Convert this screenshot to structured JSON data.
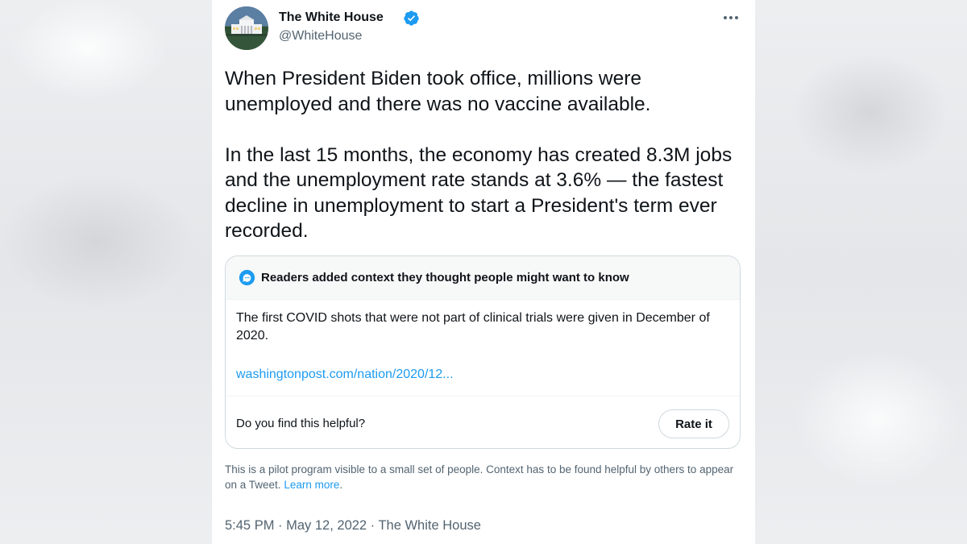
{
  "account": {
    "name": "The White House",
    "handle": "@WhiteHouse",
    "verified_color": "#1d9bf0"
  },
  "tweet": {
    "text": "When President Biden took office, millions were unemployed and there was no vaccine available.\n\nIn the last 15 months, the economy has created 8.3M jobs and the unemployment rate stands at 3.6% — the fastest decline in unemployment to start a President's term ever recorded.",
    "timestamp": "5:45 PM · May 12, 2022 · The White House"
  },
  "community_note": {
    "header": "Readers added context they thought people might want to know",
    "body": "The first COVID shots that were not part of clinical trials were given in December of 2020.",
    "link": "washingtonpost.com/nation/2020/12...",
    "helpful_question": "Do you find this helpful?",
    "rate_label": "Rate it"
  },
  "pilot_notice": {
    "text": "This is a pilot program visible to a small set of people. Context has to be found helpful by others to appear on a Tweet.",
    "learn_more": "Learn more",
    "trailing": "."
  },
  "icons": {
    "more": "more-horizontal-icon",
    "verified": "verified-badge-icon",
    "note": "community-notes-icon"
  },
  "colors": {
    "accent": "#1d9bf0",
    "text_primary": "#0f1419",
    "text_secondary": "#536471",
    "border": "#cfd9de"
  }
}
